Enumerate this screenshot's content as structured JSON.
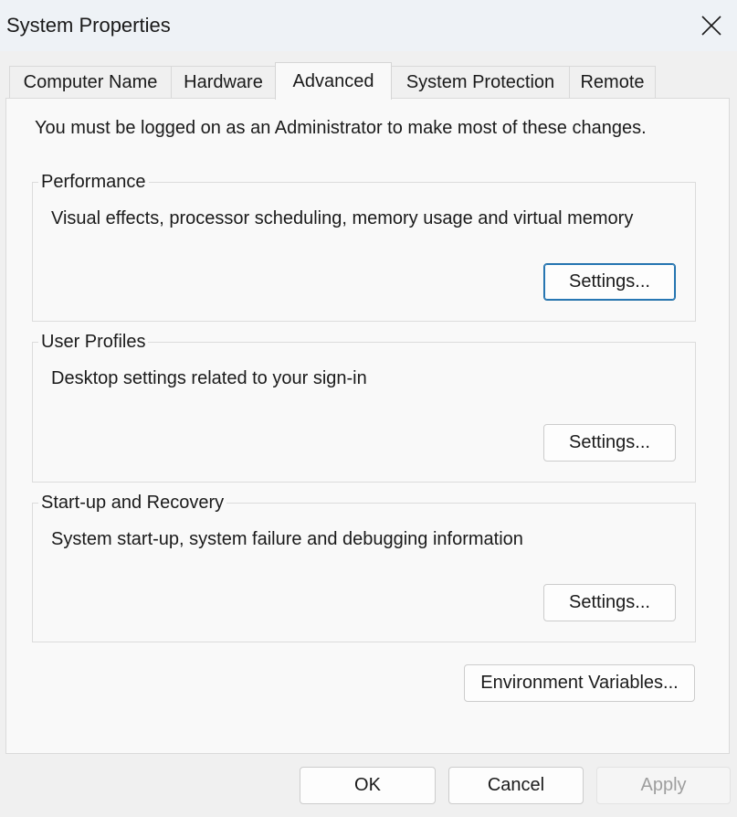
{
  "window": {
    "title": "System Properties"
  },
  "tabs": [
    {
      "label": "Computer Name",
      "active": false
    },
    {
      "label": "Hardware",
      "active": false
    },
    {
      "label": "Advanced",
      "active": true
    },
    {
      "label": "System Protection",
      "active": false
    },
    {
      "label": "Remote",
      "active": false
    }
  ],
  "advanced": {
    "admin_note": "You must be logged on as an Administrator to make most of these changes.",
    "performance": {
      "label": "Performance",
      "description": "Visual effects, processor scheduling, memory usage and virtual memory",
      "button": "Settings..."
    },
    "user_profiles": {
      "label": "User Profiles",
      "description": "Desktop settings related to your sign-in",
      "button": "Settings..."
    },
    "startup_recovery": {
      "label": "Start-up and Recovery",
      "description": "System start-up, system failure and debugging information",
      "button": "Settings..."
    },
    "env_vars_button": "Environment Variables..."
  },
  "footer": {
    "ok": "OK",
    "cancel": "Cancel",
    "apply": "Apply"
  },
  "icons": {
    "close": "close-icon"
  }
}
